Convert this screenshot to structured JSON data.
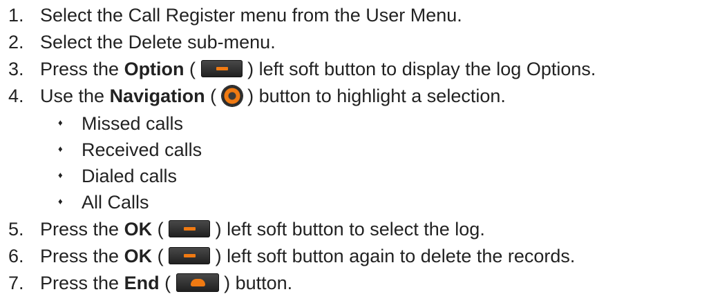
{
  "steps": [
    {
      "num": "1.",
      "pre": "Select the Call Register menu from the User Menu.",
      "bold": "",
      "after": ""
    },
    {
      "num": "2.",
      "pre": "Select the Delete sub-menu.",
      "bold": "",
      "after": ""
    },
    {
      "num": "3.",
      "pre": "Press the ",
      "bold": "Option",
      "open": " (",
      "icon": "option-soft-button-icon",
      "after": ") left soft button to display the log Options."
    },
    {
      "num": "4.",
      "pre": "Use the ",
      "bold": "Navigation",
      "open": " (",
      "icon": "navigation-button-icon",
      "after": ") button to highlight a selection."
    },
    {
      "num": "5.",
      "pre": "Press the ",
      "bold": "OK",
      "open": " (",
      "icon": "ok-soft-button-icon",
      "after": ") left soft button to select the log."
    },
    {
      "num": "6.",
      "pre": "Press the ",
      "bold": "OK",
      "open": " (",
      "icon": "ok-soft-button-icon",
      "after": ") left soft button again to delete the records."
    },
    {
      "num": "7.",
      "pre": "Press the ",
      "bold": "End",
      "open": " (",
      "icon": "end-button-icon",
      "after": ") button."
    }
  ],
  "bullets": [
    "Missed calls",
    "Received calls",
    "Dialed calls",
    "All Calls"
  ],
  "bullet_glyph": "♦",
  "colors": {
    "accent": "#f07a12",
    "button_body": "#2b2b2b",
    "text": "#222222"
  }
}
